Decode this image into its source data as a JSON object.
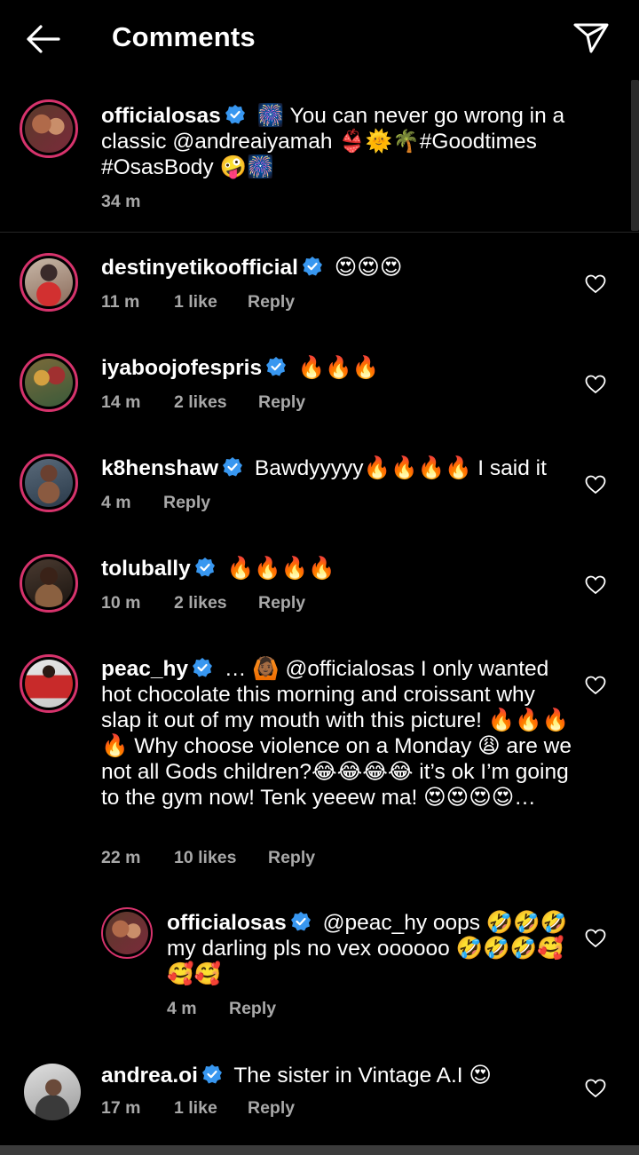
{
  "header": {
    "title": "Comments"
  },
  "colors": {
    "background": "#000000",
    "verified": "#3897f0",
    "story_ring": "#d6336c",
    "meta_text": "#a8a8a8"
  },
  "post": {
    "username": "officialosas",
    "text": "🎆 You can never go wrong in a classic @andreaiyamah 👙🌞🌴#Goodtimes #OsasBody 🤪🎆",
    "time": "34 m"
  },
  "comments": [
    {
      "username": "destinyetikoofficial",
      "text": "😍😍😍",
      "time": "11 m",
      "likes": "1 like",
      "reply": "Reply"
    },
    {
      "username": "iyaboojofespris",
      "text": "🔥🔥🔥",
      "time": "14 m",
      "likes": "2 likes",
      "reply": "Reply"
    },
    {
      "username": "k8henshaw",
      "text": "Bawdyyyyy🔥🔥🔥🔥 I said it",
      "time": "4 m",
      "likes": "",
      "reply": "Reply"
    },
    {
      "username": "tolubally",
      "text": "🔥🔥🔥🔥",
      "time": "10 m",
      "likes": "2 likes",
      "reply": "Reply"
    },
    {
      "username": "peac_hy",
      "text": "… 🙆🏾 @officialosas I only wanted hot chocolate this morning and croissant why slap it out of my mouth with this picture! 🔥🔥🔥🔥 Why choose violence on a Monday 😩 are we not all Gods children?😂😂😂😂 it’s ok I’m going to the gym now! Tenk yeeew ma! 😍😍😍😍…",
      "time": "22 m",
      "likes": "10 likes",
      "reply": "Reply"
    },
    {
      "username": "officialosas",
      "text": "@peac_hy oops 🤣🤣🤣 my darling pls no vex oooooo 🤣🤣🤣🥰🥰🥰",
      "time": "4 m",
      "likes": "",
      "reply": "Reply"
    },
    {
      "username": "andrea.oi",
      "text": "The sister in Vintage A.I 😍",
      "time": "17 m",
      "likes": "1 like",
      "reply": "Reply"
    }
  ]
}
